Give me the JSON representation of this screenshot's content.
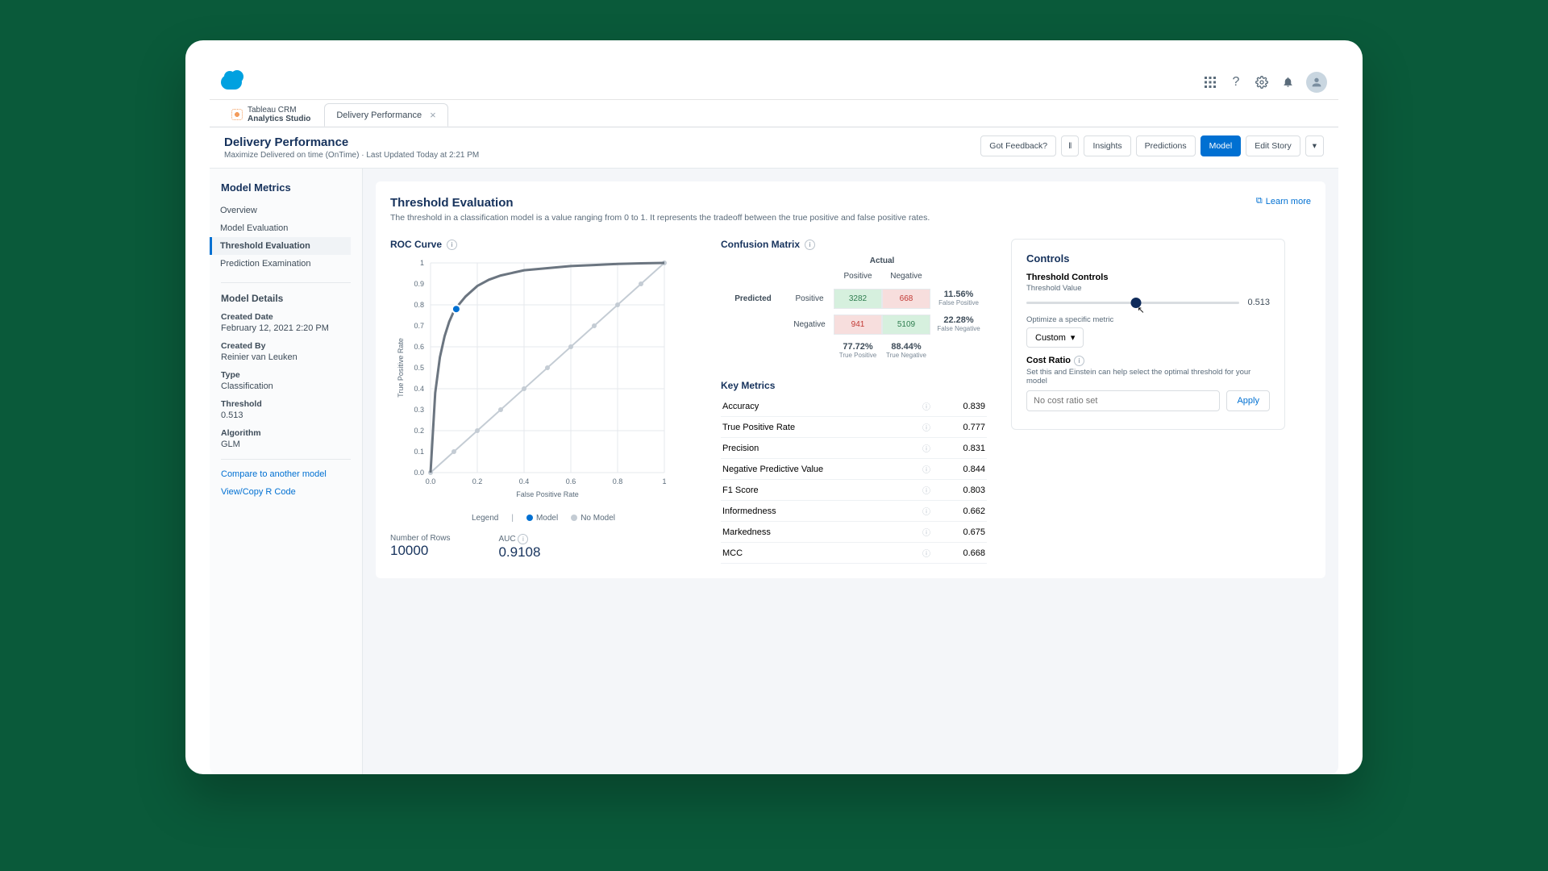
{
  "topbar": {
    "app_grid": "⊞",
    "help": "?",
    "settings": "⚙",
    "bell": "🔔"
  },
  "tabs": {
    "home_line1": "Tableau CRM",
    "home_line2": "Analytics Studio",
    "active_tab": "Delivery Performance"
  },
  "pagehead": {
    "title": "Delivery Performance",
    "subtitle": "Maximize Delivered on time (OnTime) · Last Updated Today at 2:21 PM",
    "buttons": {
      "feedback": "Got Feedback?",
      "insights": "Insights",
      "predictions": "Predictions",
      "model": "Model",
      "edit_story": "Edit Story"
    }
  },
  "sidebar": {
    "section": "Model Metrics",
    "nav": [
      "Overview",
      "Model Evaluation",
      "Threshold Evaluation",
      "Prediction Examination"
    ],
    "active_index": 2,
    "details_header": "Model Details",
    "details": [
      {
        "label": "Created Date",
        "value": "February 12, 2021 2:20 PM"
      },
      {
        "label": "Created By",
        "value": "Reinier van Leuken"
      },
      {
        "label": "Type",
        "value": "Classification"
      },
      {
        "label": "Threshold",
        "value": "0.513"
      },
      {
        "label": "Algorithm",
        "value": "GLM"
      }
    ],
    "links": [
      "Compare to another model",
      "View/Copy R Code"
    ]
  },
  "content": {
    "title": "Threshold Evaluation",
    "desc": "The threshold in a classification model is a value ranging from 0 to 1. It represents the tradeoff between the true positive and false positive rates.",
    "learn_more": "Learn more"
  },
  "roc": {
    "title": "ROC Curve",
    "xlabel": "False Positive Rate",
    "ylabel": "True Positive Rate",
    "legend_label": "Legend",
    "legend_model": "Model",
    "legend_nomodel": "No Model",
    "rows_label": "Number of Rows",
    "rows_value": "10000",
    "auc_label": "AUC",
    "auc_value": "0.9108",
    "threshold_point": {
      "fpr": 0.11,
      "tpr": 0.78
    }
  },
  "confusion": {
    "title": "Confusion Matrix",
    "actual": "Actual",
    "predicted": "Predicted",
    "pos": "Positive",
    "neg": "Negative",
    "tp": "3282",
    "fp": "668",
    "fn": "941",
    "tn": "5109",
    "fp_rate": "11.56%",
    "fp_lab": "False Positive",
    "fn_rate": "22.28%",
    "fn_lab": "False Negative",
    "col_pos": "77.72%",
    "col_pos_lab": "True Positive",
    "col_neg": "88.44%",
    "col_neg_lab": "True Negative"
  },
  "metrics": {
    "title": "Key Metrics",
    "rows": [
      {
        "n": "Accuracy",
        "v": "0.839"
      },
      {
        "n": "True Positive Rate",
        "v": "0.777"
      },
      {
        "n": "Precision",
        "v": "0.831"
      },
      {
        "n": "Negative Predictive Value",
        "v": "0.844"
      },
      {
        "n": "F1 Score",
        "v": "0.803"
      },
      {
        "n": "Informedness",
        "v": "0.662"
      },
      {
        "n": "Markedness",
        "v": "0.675"
      },
      {
        "n": "MCC",
        "v": "0.668"
      }
    ]
  },
  "controls": {
    "header": "Controls",
    "threshold_controls": "Threshold Controls",
    "threshold_value_label": "Threshold Value",
    "threshold_value": "0.513",
    "optimize_label": "Optimize a specific metric",
    "optimize_value": "Custom",
    "cost_ratio_label": "Cost Ratio",
    "cost_ratio_desc": "Set this and Einstein can help select the optimal threshold for your model",
    "cost_placeholder": "No cost ratio set",
    "apply": "Apply"
  },
  "chart_data": {
    "type": "line",
    "title": "ROC Curve",
    "xlabel": "False Positive Rate",
    "ylabel": "True Positive Rate",
    "xlim": [
      0,
      1
    ],
    "ylim": [
      0,
      1
    ],
    "series": [
      {
        "name": "Model",
        "x": [
          0,
          0.02,
          0.04,
          0.06,
          0.08,
          0.1,
          0.12,
          0.15,
          0.2,
          0.25,
          0.3,
          0.4,
          0.5,
          0.6,
          0.7,
          0.8,
          0.9,
          1.0
        ],
        "y": [
          0,
          0.38,
          0.55,
          0.65,
          0.72,
          0.77,
          0.8,
          0.84,
          0.89,
          0.92,
          0.94,
          0.965,
          0.975,
          0.985,
          0.99,
          0.995,
          0.998,
          1.0
        ]
      },
      {
        "name": "No Model",
        "x": [
          0,
          0.1,
          0.2,
          0.3,
          0.4,
          0.5,
          0.6,
          0.7,
          0.8,
          0.9,
          1.0
        ],
        "y": [
          0,
          0.1,
          0.2,
          0.3,
          0.4,
          0.5,
          0.6,
          0.7,
          0.8,
          0.9,
          1.0
        ]
      }
    ],
    "threshold_marker": {
      "fpr": 0.11,
      "tpr": 0.78,
      "threshold": 0.513
    },
    "auc": 0.9108,
    "n_rows": 10000
  }
}
